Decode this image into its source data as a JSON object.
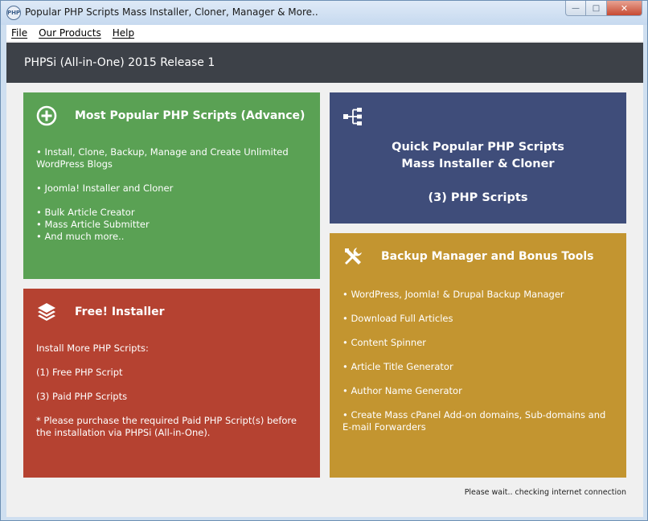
{
  "window": {
    "title": "Popular PHP Scripts Mass Installer, Cloner, Manager & More..",
    "icon_text": "PHP",
    "controls": {
      "minimize": "—",
      "maximize": "□",
      "close": "✕"
    }
  },
  "menu": {
    "items": [
      {
        "label": "File"
      },
      {
        "label": "Our Products"
      },
      {
        "label": "Help"
      }
    ]
  },
  "header": {
    "title": "PHPSi (All-in-One) 2015 Release 1"
  },
  "tiles": {
    "popular": {
      "title": "Most Popular PHP Scripts (Advance)",
      "icon": "plus-circle-icon",
      "lines": [
        "• Install, Clone, Backup, Manage and Create Unlimited WordPress Blogs",
        "• Joomla! Installer and Cloner",
        "• Bulk Article Creator",
        "• Mass Article Submitter",
        "• And much more.."
      ],
      "color": "#5aa154"
    },
    "quick": {
      "line1": "Quick Popular PHP Scripts",
      "line2": "Mass Installer & Cloner",
      "line3": "(3) PHP Scripts",
      "icon": "sitemap-icon",
      "color": "#3f4d7a"
    },
    "free": {
      "title": "Free! Installer",
      "icon": "layers-icon",
      "lines": [
        "Install More PHP Scripts:",
        "(1) Free PHP Script",
        "(3) Paid PHP Scripts",
        "* Please purchase the required Paid PHP Script(s) before the installation via PHPSi (All-in-One)."
      ],
      "color": "#b54231"
    },
    "backup": {
      "title": "Backup Manager and Bonus Tools",
      "icon": "tools-icon",
      "lines": [
        "• WordPress, Joomla! & Drupal Backup Manager",
        "• Download Full Articles",
        "• Content Spinner",
        "• Article Title Generator",
        "• Author Name Generator",
        "• Create Mass cPanel Add-on domains, Sub-domains and E-mail Forwarders"
      ],
      "color": "#c39530"
    }
  },
  "status": {
    "text": "Please wait.. checking internet connection"
  }
}
